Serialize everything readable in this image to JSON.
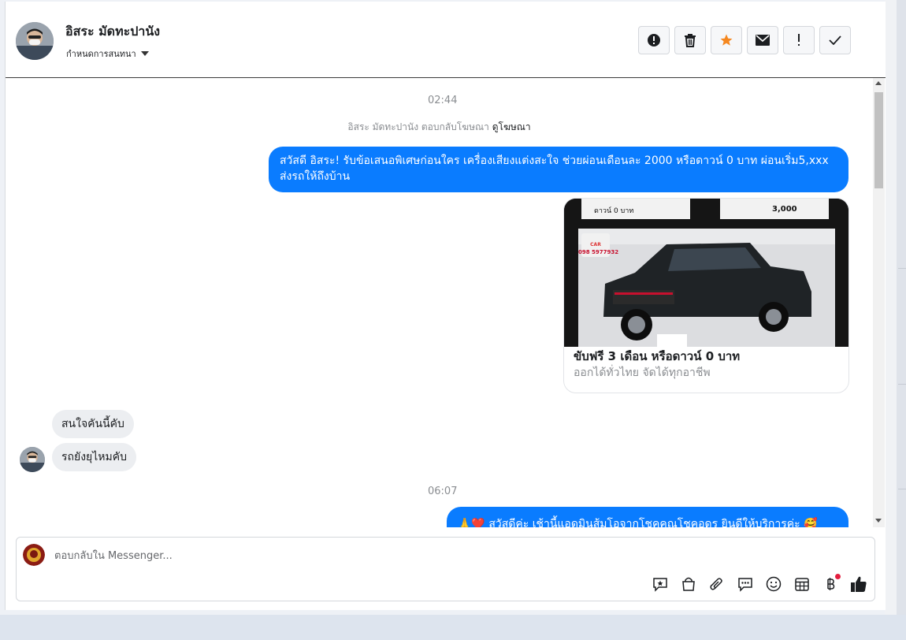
{
  "header": {
    "contact_name": "อิสระ มัดทะปานัง",
    "assign_label": "กำหนดการสนทนา",
    "toolbar": [
      {
        "name": "spam-button",
        "icon": "alert-circle-icon"
      },
      {
        "name": "delete-button",
        "icon": "trash-icon"
      },
      {
        "name": "star-button",
        "icon": "star-icon"
      },
      {
        "name": "mark-unread-button",
        "icon": "envelope-icon"
      },
      {
        "name": "follow-up-button",
        "icon": "exclamation-icon"
      },
      {
        "name": "done-button",
        "icon": "check-icon"
      }
    ]
  },
  "conversation": {
    "time1": "02:44",
    "notice_text": "อิสระ มัดทะปานัง ตอบกลับโฆษณา",
    "notice_link": "ดูโฆษณา",
    "outgoing1": "สวัสดี อิสระ! รับข้อเสนอพิเศษก่อนใคร เครื่องเสียงแต่งสะใจ ช่วยผ่อนเดือนละ 2000 หรือดาวน์ 0 บาท ผ่อนเริ่ม5,xxx ส่งรถให้ถึงบ้าน",
    "ad": {
      "image_text_left": "ดาวน์ 0 บาท",
      "image_text_right": "3,000",
      "image_phone": "098 5977932",
      "title": "ขับฟรี 3 เดือน หรือดาวน์ 0 บาท",
      "subtitle": "ออกได้ทั่วไทย จัดได้ทุกอาชีพ"
    },
    "incoming1": "สนใจคันนี้คับ",
    "incoming2": "รถยังยุไหมคับ",
    "time2": "06:07",
    "outgoing2": "🙏❤️ สวัสดีค่ะ เช้านี้แอดมินส้มโอจากโชคคุณโชคอุดร ยินดีให้บริการค่ะ 🥰"
  },
  "composer": {
    "placeholder": "ตอบกลับใน Messenger...",
    "icons": [
      "saved-reply-icon",
      "shop-bag-icon",
      "attachment-icon",
      "chat-bubble-icon",
      "emoji-icon",
      "calendar-icon",
      "baht-payment-icon",
      "like-icon"
    ]
  },
  "colors": {
    "accent_blue": "#0a7cff",
    "star_orange": "#f5871f",
    "incoming_bg": "#eceef1"
  }
}
